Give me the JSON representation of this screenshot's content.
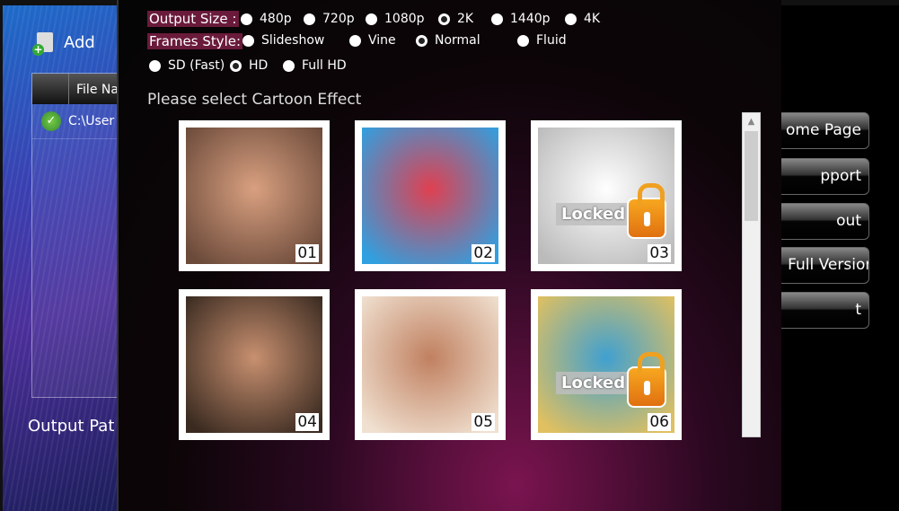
{
  "back_window": {
    "add_label": "Add",
    "file_header": "File Na",
    "file_row": "C:\\User",
    "output_path_label": "Output Pat"
  },
  "right_buttons": [
    "ome Page",
    "pport",
    "out",
    ": Full Version",
    "t"
  ],
  "output_size": {
    "label": "Output Size :",
    "options": [
      "480p",
      "720p",
      "1080p",
      "2K",
      "1440p",
      "4K"
    ],
    "selected": "2K"
  },
  "frames_style": {
    "label": "Frames Style:",
    "options": [
      "Slideshow",
      "Vine",
      "Normal",
      "Fluid"
    ],
    "selected": "Normal"
  },
  "quality": {
    "options": [
      "SD (Fast)",
      "HD",
      "Full HD"
    ],
    "selected": "HD"
  },
  "effects_title": "Please select Cartoon Effect",
  "locked_label": "Locked",
  "effects": [
    {
      "num": "01",
      "locked": false,
      "colors": [
        "#d9a080",
        "#6b4a3a"
      ]
    },
    {
      "num": "02",
      "locked": false,
      "colors": [
        "#e04050",
        "#30a0e0"
      ]
    },
    {
      "num": "03",
      "locked": true,
      "colors": [
        "#ffffff",
        "#bbbbbb"
      ]
    },
    {
      "num": "04",
      "locked": false,
      "colors": [
        "#c89070",
        "#3a2a20"
      ]
    },
    {
      "num": "05",
      "locked": false,
      "colors": [
        "#c08060",
        "#f0e0d0"
      ]
    },
    {
      "num": "06",
      "locked": true,
      "colors": [
        "#40a0d0",
        "#e0c060"
      ]
    }
  ]
}
